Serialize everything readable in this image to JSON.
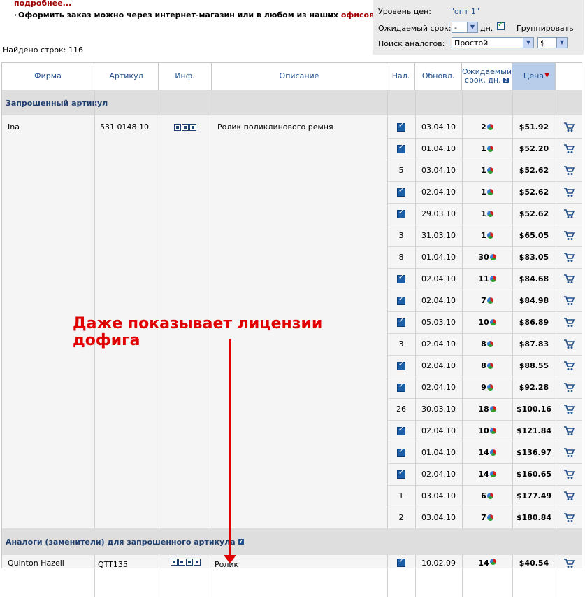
{
  "top": {
    "more_link": "подробнее...",
    "order_text": "Оформить заказ можно через интернет-магазин или в любом из наших ",
    "offices_link": "офисов",
    "found_label": "Найдено строк: 116"
  },
  "filters": {
    "price_level_label": "Уровень цен:",
    "price_level_value": "\"опт 1\"",
    "term_label": "Ожидаемый срок:",
    "term_value": "-",
    "term_unit": "дн.",
    "group_label": "Группировать",
    "group_checked": true,
    "analog_label": "Поиск аналогов:",
    "analog_value": "Простой",
    "currency_value": "$"
  },
  "columns": {
    "firm": "Фирма",
    "article": "Артикул",
    "info": "Инф.",
    "description": "Описание",
    "stock": "Нал.",
    "updated": "Обновл.",
    "term_line1": "Ожидаемый",
    "term_line2": "срок, дн.",
    "price": "Цена"
  },
  "requested": {
    "section_title": "Запрошенный артикул",
    "firm": "Ina",
    "article": "531 0148 10",
    "description": "Ролик поликлинового ремня",
    "rows": [
      {
        "stock": "check",
        "updated": "03.04.10",
        "days": "2",
        "price": "$51.92"
      },
      {
        "stock": "check",
        "updated": "01.04.10",
        "days": "1",
        "price": "$52.20"
      },
      {
        "stock": "5",
        "updated": "03.04.10",
        "days": "1",
        "price": "$52.62"
      },
      {
        "stock": "check",
        "updated": "02.04.10",
        "days": "1",
        "price": "$52.62"
      },
      {
        "stock": "check",
        "updated": "29.03.10",
        "days": "1",
        "price": "$52.62"
      },
      {
        "stock": "3",
        "updated": "31.03.10",
        "days": "1",
        "price": "$65.05"
      },
      {
        "stock": "8",
        "updated": "01.04.10",
        "days": "30",
        "price": "$83.05"
      },
      {
        "stock": "check",
        "updated": "02.04.10",
        "days": "11",
        "price": "$84.68"
      },
      {
        "stock": "check",
        "updated": "02.04.10",
        "days": "7",
        "price": "$84.98"
      },
      {
        "stock": "check",
        "updated": "05.03.10",
        "days": "10",
        "price": "$86.89"
      },
      {
        "stock": "3",
        "updated": "02.04.10",
        "days": "8",
        "price": "$87.83"
      },
      {
        "stock": "check",
        "updated": "02.04.10",
        "days": "8",
        "price": "$88.55"
      },
      {
        "stock": "check",
        "updated": "02.04.10",
        "days": "9",
        "price": "$92.28"
      },
      {
        "stock": "26",
        "updated": "30.03.10",
        "days": "18",
        "price": "$100.16"
      },
      {
        "stock": "check",
        "updated": "02.04.10",
        "days": "10",
        "price": "$121.84"
      },
      {
        "stock": "check",
        "updated": "01.04.10",
        "days": "14",
        "price": "$136.97"
      },
      {
        "stock": "check",
        "updated": "02.04.10",
        "days": "14",
        "price": "$160.65"
      },
      {
        "stock": "1",
        "updated": "03.04.10",
        "days": "6",
        "price": "$177.49"
      },
      {
        "stock": "2",
        "updated": "03.04.10",
        "days": "7",
        "price": "$180.84"
      }
    ]
  },
  "analogs": {
    "section_title": "Аналоги (заменители) для запрошенного артикула",
    "rows": [
      {
        "firm": "Quinton Hazell",
        "article": "QTT135",
        "description": "Ролик",
        "stock": "check",
        "updated": "10.02.09",
        "days": "14",
        "price": "$40.54"
      }
    ]
  },
  "annotation": {
    "line1": "Даже показывает лицензии",
    "line2": "дофига",
    "color": "#e00000"
  },
  "icons": {
    "sort": "sort-desc-arrow-icon",
    "help": "help-question-icon",
    "cart": "shopping-cart-icon",
    "pie": "supplier-stats-pie-icon"
  }
}
